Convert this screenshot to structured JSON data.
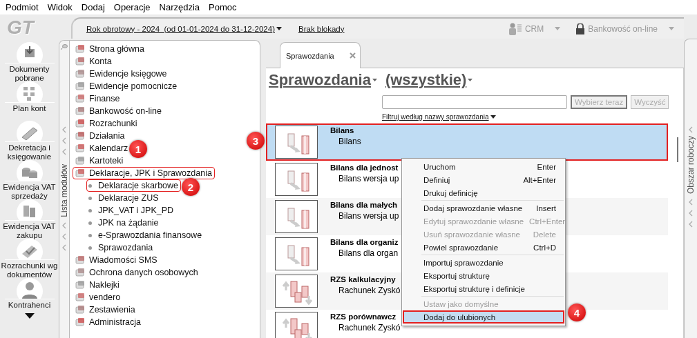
{
  "menu_bar": [
    "Podmiot",
    "Widok",
    "Dodaj",
    "Operacje",
    "Narzędzia",
    "Pomoc"
  ],
  "logo": "GT",
  "header": {
    "fiscal_year": "Rok obrotowy - 2024  (od 01-01-2024 do 31-12-2024)",
    "lock_status": "Brak blokady",
    "crm": "CRM",
    "banking": "Bankowość on-line"
  },
  "sidebar": {
    "items": [
      {
        "label": "Dokumenty pobrane"
      },
      {
        "label": "Plan kont"
      },
      {
        "label": "Dekretacja i księgowanie"
      },
      {
        "label": "Ewidencja VAT sprzedaży"
      },
      {
        "label": "Ewidencja VAT zakupu"
      },
      {
        "label": "Rozrachunki wg dokumentów"
      },
      {
        "label": "Kontrahenci"
      }
    ]
  },
  "module_panel": {
    "title": "Lista modułów",
    "items": [
      {
        "label": "Strona główna",
        "highlighted": false
      },
      {
        "label": "Konta",
        "highlighted": false
      },
      {
        "label": "Ewidencje księgowe",
        "highlighted": false
      },
      {
        "label": "Ewidencje pomocnicze",
        "highlighted": false
      },
      {
        "label": "Finanse",
        "highlighted": false
      },
      {
        "label": "Bankowość on-line",
        "highlighted": false
      },
      {
        "label": "Rozrachunki",
        "highlighted": false
      },
      {
        "label": "Działania",
        "highlighted": false
      },
      {
        "label": "Kalendarz",
        "highlighted": false
      },
      {
        "label": "Kartoteki",
        "highlighted": false
      },
      {
        "label": "Deklaracje, JPK i Sprawozdania",
        "highlighted": true,
        "children": [
          {
            "label": "Deklaracje skarbowe",
            "highlighted": true
          },
          {
            "label": "Deklaracje ZUS",
            "highlighted": false
          },
          {
            "label": "JPK_VAT i JPK_PD",
            "highlighted": false
          },
          {
            "label": "JPK na żądanie",
            "highlighted": false
          },
          {
            "label": "e-Sprawozdania finansowe",
            "highlighted": false
          },
          {
            "label": "Sprawozdania",
            "highlighted": false
          }
        ]
      },
      {
        "label": "Wiadomości SMS",
        "highlighted": false
      },
      {
        "label": "Ochrona danych osobowych",
        "highlighted": false
      },
      {
        "label": "Naklejki",
        "highlighted": false
      },
      {
        "label": "vendero",
        "highlighted": false
      },
      {
        "label": "Zestawienia",
        "highlighted": false
      },
      {
        "label": "Administracja",
        "highlighted": false
      }
    ]
  },
  "tabs": [
    {
      "label": "Sprawozdania",
      "selected": true
    }
  ],
  "report_header": {
    "category": "Sprawozdania",
    "filter": "(wszystkie)",
    "buttons": [
      {
        "label": "Wybierz teraz",
        "disabled": true
      },
      {
        "label": "Wyczyść",
        "disabled": true
      }
    ],
    "filter_link": "Filtruj według nazwy sprawozdania"
  },
  "reports": [
    {
      "title": "Bilans",
      "subtitle": "Bilans",
      "kind": "balance",
      "selected": true,
      "highlighted": true
    },
    {
      "title": "Bilans dla jednost",
      "subtitle": "Bilans wersja up",
      "kind": "balance",
      "selected": false,
      "highlighted": false
    },
    {
      "title": "Bilans dla małych",
      "subtitle": "Bilans wersja up",
      "kind": "balance",
      "selected": false,
      "highlighted": false
    },
    {
      "title": "Bilans dla organiz",
      "subtitle": "Bilans dla organ",
      "kind": "balance",
      "selected": false,
      "highlighted": false
    },
    {
      "title": "RZS kalkulacyjny",
      "subtitle": "Rachunek Zyskó",
      "kind": "profit",
      "selected": false,
      "highlighted": false
    },
    {
      "title": "RZS porównawcz",
      "subtitle": "Rachunek Zyskó",
      "kind": "profit",
      "selected": false,
      "highlighted": false
    }
  ],
  "context_menu": [
    {
      "kind": "item",
      "label": "Uruchom",
      "shortcut": "Enter",
      "disabled": false,
      "highlighted": false
    },
    {
      "kind": "item",
      "label": "Definiuj",
      "shortcut": "Alt+Enter",
      "disabled": false,
      "highlighted": false
    },
    {
      "kind": "item",
      "label": "Drukuj definicję",
      "disabled": false,
      "highlighted": false
    },
    {
      "kind": "separator"
    },
    {
      "kind": "item",
      "label": "Dodaj sprawozdanie własne",
      "shortcut": "Insert",
      "disabled": false,
      "highlighted": false
    },
    {
      "kind": "item",
      "label": "Edytuj sprawozdanie własne",
      "shortcut": "Ctrl+Enter",
      "disabled": true,
      "highlighted": false
    },
    {
      "kind": "item",
      "label": "Usuń sprawozdanie własne",
      "shortcut": "Delete",
      "disabled": true,
      "highlighted": false
    },
    {
      "kind": "item",
      "label": "Powiel sprawozdanie",
      "shortcut": "Ctrl+D",
      "disabled": false,
      "highlighted": false
    },
    {
      "kind": "separator"
    },
    {
      "kind": "item",
      "label": "Importuj sprawozdanie",
      "disabled": false,
      "highlighted": false
    },
    {
      "kind": "item",
      "label": "Eksportuj strukturę",
      "disabled": false,
      "highlighted": false
    },
    {
      "kind": "item",
      "label": "Eksportuj strukturę i definicje",
      "disabled": false,
      "highlighted": false
    },
    {
      "kind": "separator"
    },
    {
      "kind": "item",
      "label": "Ustaw jako domyślne",
      "disabled": true,
      "highlighted": false
    },
    {
      "kind": "item",
      "label": "Dodaj do ulubionych",
      "disabled": false,
      "highlighted": true
    }
  ],
  "workspace_strip": {
    "title": "Obszar roboczy"
  },
  "annotations": [
    "1",
    "2",
    "3",
    "4"
  ]
}
